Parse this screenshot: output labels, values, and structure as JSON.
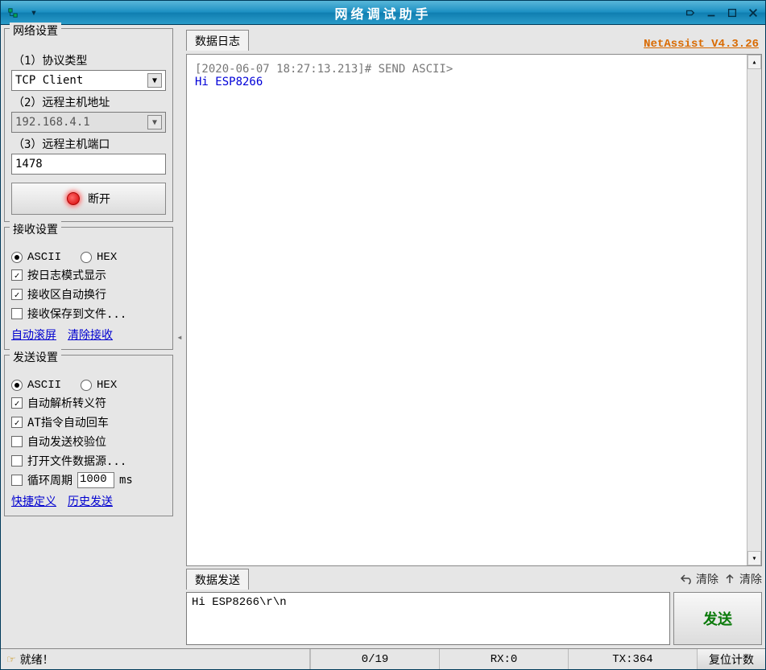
{
  "titlebar": {
    "title": "网络调试助手"
  },
  "version": "NetAssist V4.3.26",
  "net": {
    "legend": "网络设置",
    "proto_label": "（1）协议类型",
    "proto_value": "TCP Client",
    "host_label": "（2）远程主机地址",
    "host_value": "192.168.4.1",
    "port_label": "（3）远程主机端口",
    "port_value": "1478",
    "disconnect": "断开"
  },
  "recv": {
    "legend": "接收设置",
    "ascii": "ASCII",
    "hex": "HEX",
    "opt1": "按日志模式显示",
    "opt2": "接收区自动换行",
    "opt3": "接收保存到文件...",
    "auto_scroll": "自动滚屏",
    "clear_recv": "清除接收"
  },
  "send": {
    "legend": "发送设置",
    "ascii": "ASCII",
    "hex": "HEX",
    "opt1": "自动解析转义符",
    "opt2": "AT指令自动回车",
    "opt3": "自动发送校验位",
    "opt4": "打开文件数据源...",
    "cycle_label": "循环周期",
    "cycle_value": "1000",
    "cycle_unit": "ms",
    "quick": "快捷定义",
    "history": "历史发送"
  },
  "log": {
    "tab": "数据日志",
    "meta": "[2020-06-07 18:27:13.213]# SEND ASCII>",
    "body": "Hi ESP8266"
  },
  "sendpanel": {
    "tab": "数据发送",
    "clear_left": "清除",
    "clear_right": "清除",
    "input": "Hi ESP8266\\r\\n",
    "button": "发送"
  },
  "status": {
    "ready": "就绪！",
    "bytes": "0/19",
    "rx": "RX:0",
    "tx": "TX:364",
    "reset": "复位计数"
  }
}
